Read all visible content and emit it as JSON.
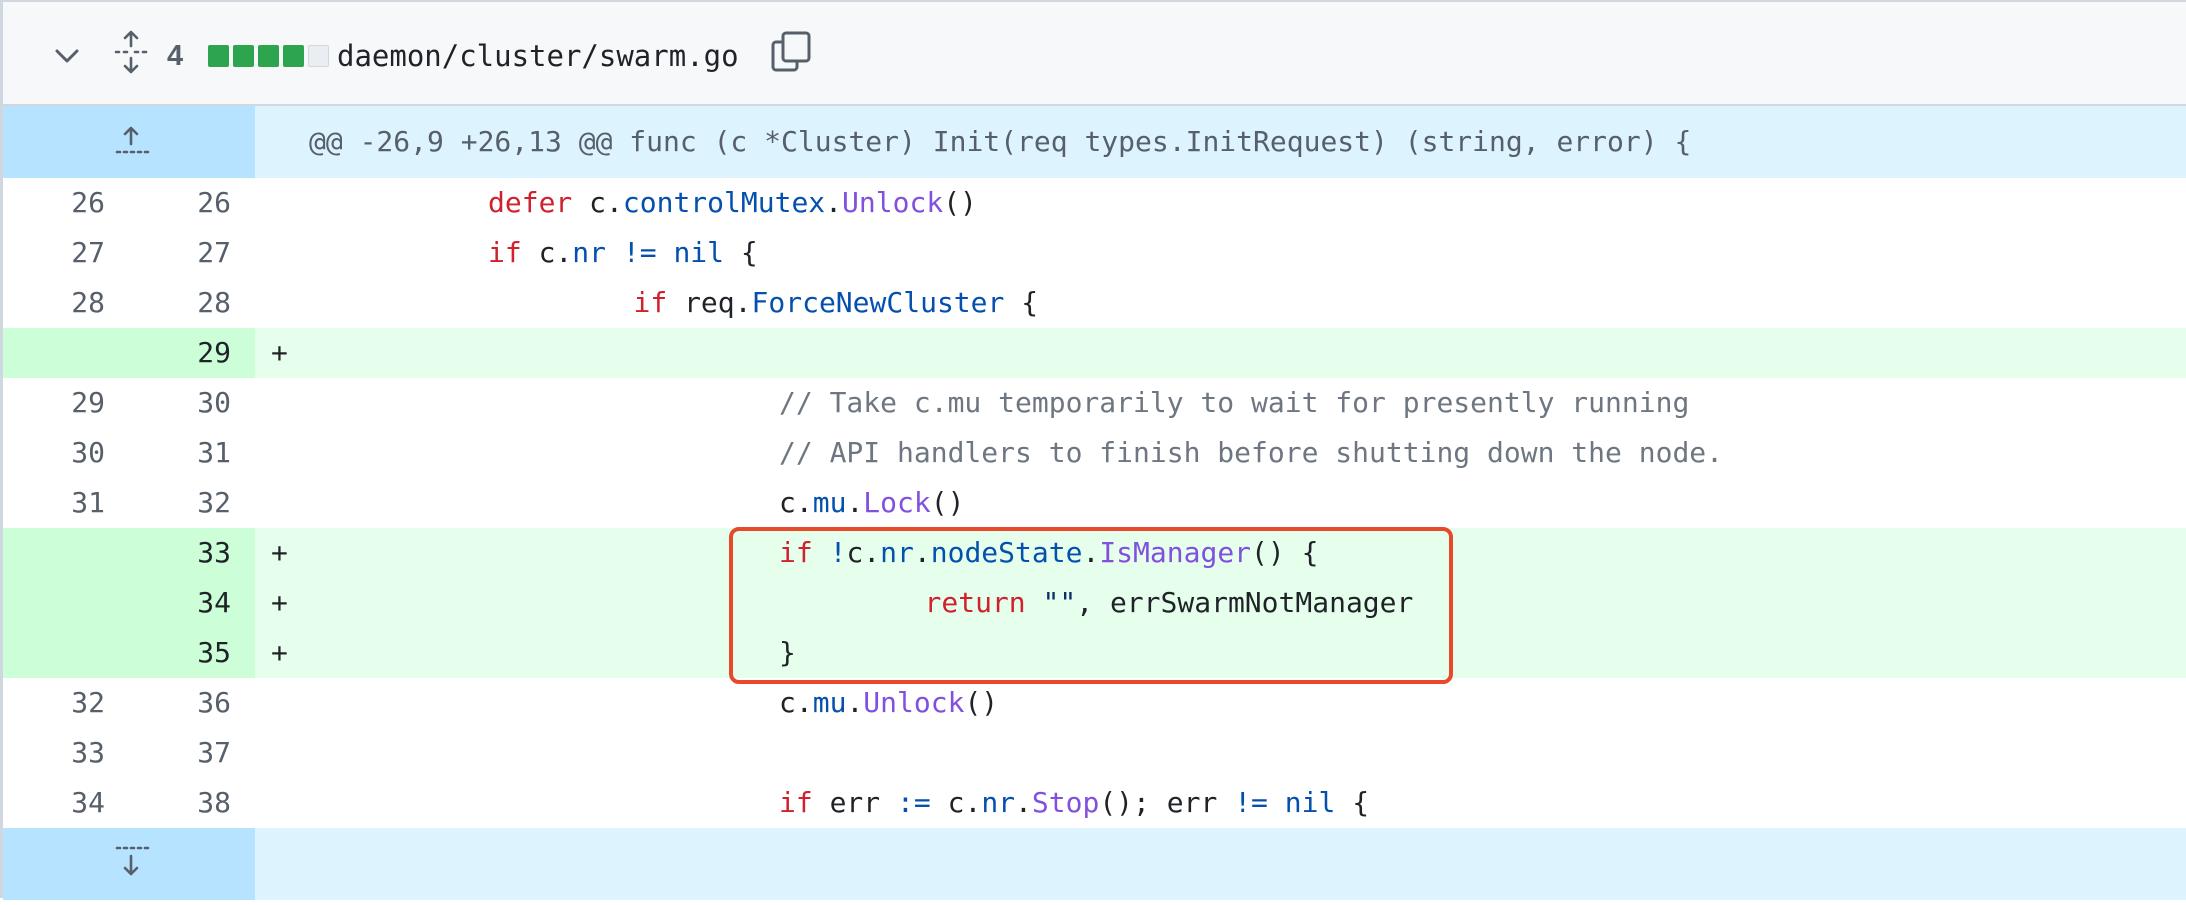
{
  "header": {
    "change_count": "4",
    "diffstat_blocks": [
      "#2da44e",
      "#2da44e",
      "#2da44e",
      "#2da44e",
      "#eaeef2"
    ],
    "file_path": "daemon/cluster/swarm.go",
    "icons": [
      "chevron-down-icon",
      "unfold-icon",
      "copy-icon"
    ]
  },
  "hunk": {
    "header": "@@ -26,9 +26,13 @@ func (c *Cluster) Init(req types.InitRequest) (string, error) {"
  },
  "lines": [
    {
      "old": "26",
      "new": "26",
      "type": "context",
      "tokens": [
        {
          "t": "\t\t",
          "c": "tx"
        },
        {
          "t": "defer",
          "c": "kw"
        },
        {
          "t": " c.",
          "c": "tx"
        },
        {
          "t": "controlMutex",
          "c": "id"
        },
        {
          "t": ".",
          "c": "tx"
        },
        {
          "t": "Unlock",
          "c": "fn"
        },
        {
          "t": "()",
          "c": "tx"
        }
      ]
    },
    {
      "old": "27",
      "new": "27",
      "type": "context",
      "tokens": [
        {
          "t": "\t\t",
          "c": "tx"
        },
        {
          "t": "if",
          "c": "kw"
        },
        {
          "t": " c.",
          "c": "tx"
        },
        {
          "t": "nr",
          "c": "id"
        },
        {
          "t": " ",
          "c": "tx"
        },
        {
          "t": "!=",
          "c": "op"
        },
        {
          "t": " ",
          "c": "tx"
        },
        {
          "t": "nil",
          "c": "id"
        },
        {
          "t": " {",
          "c": "tx"
        }
      ]
    },
    {
      "old": "28",
      "new": "28",
      "type": "context",
      "tokens": [
        {
          "t": "\t\t\t",
          "c": "tx"
        },
        {
          "t": "if",
          "c": "kw"
        },
        {
          "t": " req.",
          "c": "tx"
        },
        {
          "t": "ForceNewCluster",
          "c": "id"
        },
        {
          "t": " {",
          "c": "tx"
        }
      ]
    },
    {
      "old": "",
      "new": "29",
      "type": "add",
      "tokens": []
    },
    {
      "old": "29",
      "new": "30",
      "type": "context",
      "tokens": [
        {
          "t": "\t\t\t\t",
          "c": "tx"
        },
        {
          "t": "// Take c.mu temporarily to wait for presently running",
          "c": "cm"
        }
      ]
    },
    {
      "old": "30",
      "new": "31",
      "type": "context",
      "tokens": [
        {
          "t": "\t\t\t\t",
          "c": "tx"
        },
        {
          "t": "// API handlers to finish before shutting down the node.",
          "c": "cm"
        }
      ]
    },
    {
      "old": "31",
      "new": "32",
      "type": "context",
      "tokens": [
        {
          "t": "\t\t\t\t",
          "c": "tx"
        },
        {
          "t": "c.",
          "c": "tx"
        },
        {
          "t": "mu",
          "c": "id"
        },
        {
          "t": ".",
          "c": "tx"
        },
        {
          "t": "Lock",
          "c": "fn"
        },
        {
          "t": "()",
          "c": "tx"
        }
      ]
    },
    {
      "old": "",
      "new": "33",
      "type": "add",
      "tokens": [
        {
          "t": "\t\t\t\t",
          "c": "tx"
        },
        {
          "t": "if",
          "c": "kw"
        },
        {
          "t": " ",
          "c": "tx"
        },
        {
          "t": "!",
          "c": "op"
        },
        {
          "t": "c.",
          "c": "tx"
        },
        {
          "t": "nr",
          "c": "id"
        },
        {
          "t": ".",
          "c": "tx"
        },
        {
          "t": "nodeState",
          "c": "id"
        },
        {
          "t": ".",
          "c": "tx"
        },
        {
          "t": "IsManager",
          "c": "fn"
        },
        {
          "t": "() {",
          "c": "tx"
        }
      ]
    },
    {
      "old": "",
      "new": "34",
      "type": "add",
      "tokens": [
        {
          "t": "\t\t\t\t\t",
          "c": "tx"
        },
        {
          "t": "return",
          "c": "kw"
        },
        {
          "t": " ",
          "c": "tx"
        },
        {
          "t": "\"\"",
          "c": "str"
        },
        {
          "t": ", errSwarmNotManager",
          "c": "tx"
        }
      ]
    },
    {
      "old": "",
      "new": "35",
      "type": "add",
      "tokens": [
        {
          "t": "\t\t\t\t",
          "c": "tx"
        },
        {
          "t": "}",
          "c": "tx"
        }
      ]
    },
    {
      "old": "32",
      "new": "36",
      "type": "context",
      "tokens": [
        {
          "t": "\t\t\t\t",
          "c": "tx"
        },
        {
          "t": "c.",
          "c": "tx"
        },
        {
          "t": "mu",
          "c": "id"
        },
        {
          "t": ".",
          "c": "tx"
        },
        {
          "t": "Unlock",
          "c": "fn"
        },
        {
          "t": "()",
          "c": "tx"
        }
      ]
    },
    {
      "old": "33",
      "new": "37",
      "type": "context",
      "tokens": []
    },
    {
      "old": "34",
      "new": "38",
      "type": "context",
      "tokens": [
        {
          "t": "\t\t\t\t",
          "c": "tx"
        },
        {
          "t": "if",
          "c": "kw"
        },
        {
          "t": " err ",
          "c": "tx"
        },
        {
          "t": ":=",
          "c": "op"
        },
        {
          "t": " c.",
          "c": "tx"
        },
        {
          "t": "nr",
          "c": "id"
        },
        {
          "t": ".",
          "c": "tx"
        },
        {
          "t": "Stop",
          "c": "fn"
        },
        {
          "t": "(); err ",
          "c": "tx"
        },
        {
          "t": "!=",
          "c": "op"
        },
        {
          "t": " ",
          "c": "tx"
        },
        {
          "t": "nil",
          "c": "id"
        },
        {
          "t": " {",
          "c": "tx"
        }
      ]
    }
  ],
  "add_marker": "+",
  "colors": {
    "hunk_bg": "#ddf4ff",
    "hunk_gutter": "#b6e3ff",
    "add_bg": "#e6ffec",
    "add_gutter": "#ccffd8",
    "highlight_border": "#e8492b"
  }
}
